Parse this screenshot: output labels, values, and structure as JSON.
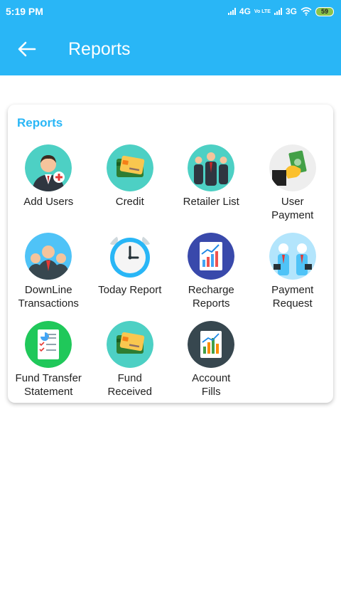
{
  "status_bar": {
    "time": "5:19 PM",
    "network1": "4G",
    "volte": "Vo LTE",
    "network2": "3G",
    "battery": "59"
  },
  "toolbar": {
    "title": "Reports"
  },
  "card": {
    "title": "Reports",
    "items": [
      {
        "label": "Add Users",
        "icon": "add-user-icon"
      },
      {
        "label": "Credit",
        "icon": "credit-card-icon"
      },
      {
        "label": "Retailer List",
        "icon": "group-icon"
      },
      {
        "label": "User\nPayment",
        "icon": "hand-money-icon"
      },
      {
        "label": "DownLine\nTransactions",
        "icon": "team-icon"
      },
      {
        "label": "Today Report",
        "icon": "alarm-clock-icon"
      },
      {
        "label": "Recharge\nReports",
        "icon": "report-chart-icon"
      },
      {
        "label": "Payment\nRequest",
        "icon": "businessmen-icon"
      },
      {
        "label": "Fund Transfer\nStatement",
        "icon": "statement-doc-icon"
      },
      {
        "label": "Fund\nReceived",
        "icon": "credit-card-icon"
      },
      {
        "label": "Account\nFills",
        "icon": "bar-chart-doc-icon"
      }
    ]
  },
  "colors": {
    "primary": "#29b6f6",
    "teal": "#4dd0c4",
    "green": "#20c85a",
    "navy": "#37474f"
  }
}
